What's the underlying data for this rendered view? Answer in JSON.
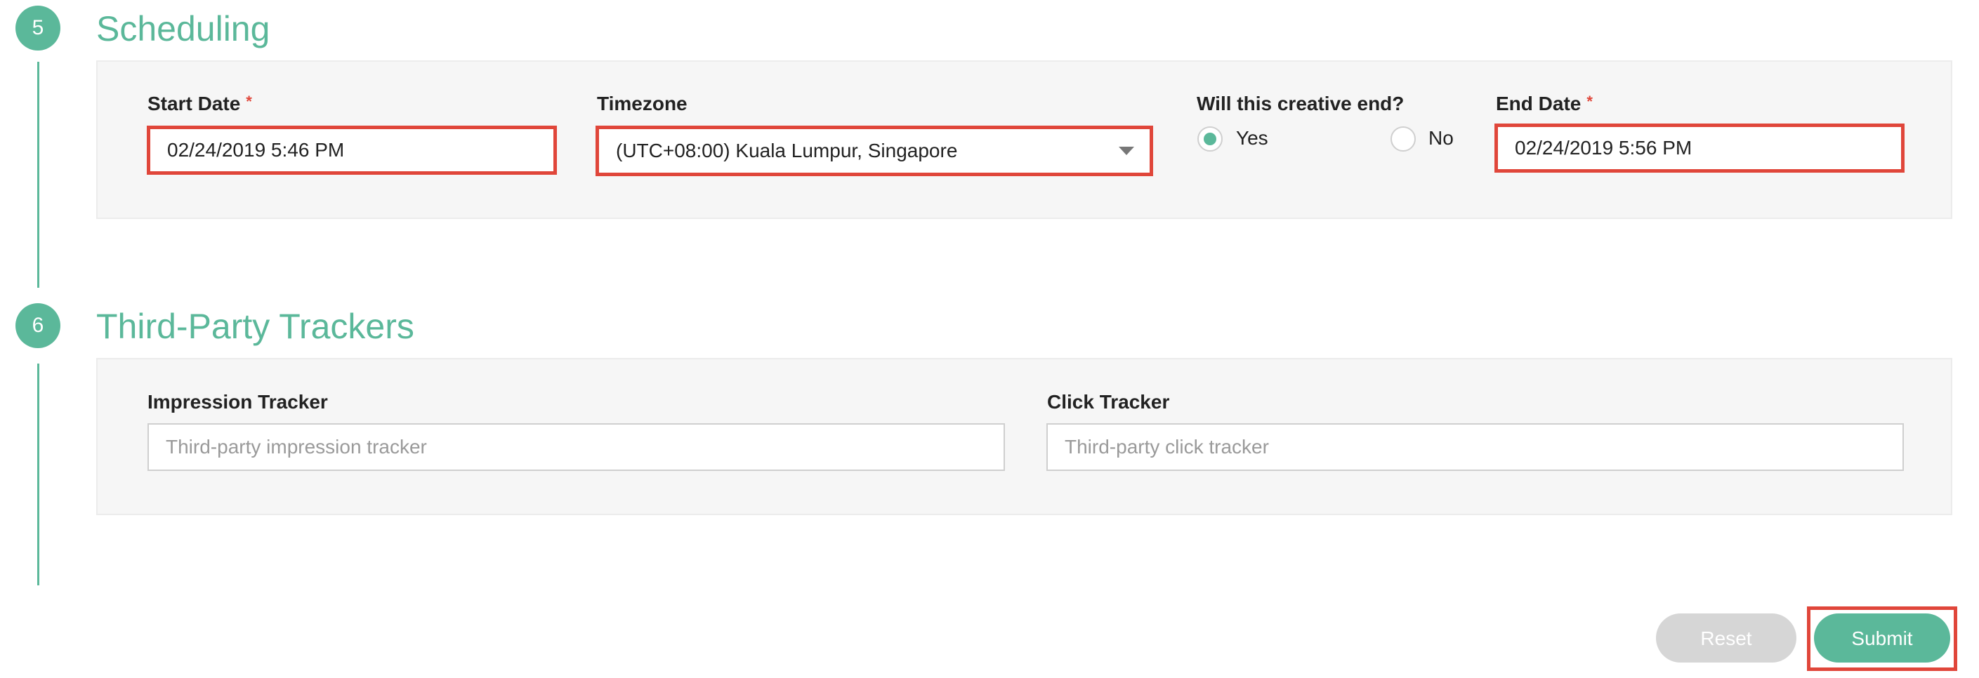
{
  "timeline_color": "#5bb89a",
  "highlight_color": "#e0463a",
  "scheduling": {
    "step_number": "5",
    "title": "Scheduling",
    "start_date": {
      "label": "Start Date",
      "required_marker": "*",
      "value": "02/24/2019 5:46 PM"
    },
    "timezone": {
      "label": "Timezone",
      "value": "(UTC+08:00) Kuala Lumpur, Singapore"
    },
    "creative_end": {
      "label": "Will this creative end?",
      "options": [
        {
          "label": "Yes",
          "checked": true
        },
        {
          "label": "No",
          "checked": false
        }
      ]
    },
    "end_date": {
      "label": "End Date",
      "required_marker": "*",
      "value": "02/24/2019 5:56 PM"
    }
  },
  "trackers": {
    "step_number": "6",
    "title": "Third-Party Trackers",
    "impression": {
      "label": "Impression Tracker",
      "placeholder": "Third-party impression tracker",
      "value": ""
    },
    "click": {
      "label": "Click Tracker",
      "placeholder": "Third-party click tracker",
      "value": ""
    }
  },
  "actions": {
    "reset_label": "Reset",
    "submit_label": "Submit"
  }
}
